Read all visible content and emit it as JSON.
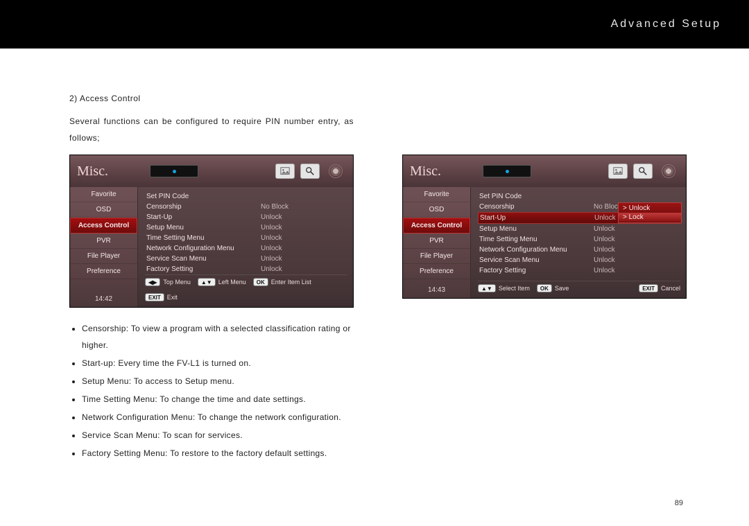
{
  "header": {
    "title": "Advanced Setup"
  },
  "page_number": "89",
  "section": {
    "heading": "2) Access Control",
    "intro": "Several functions can be configured to require PIN number entry, as follows;",
    "bullets": [
      "Censorship: To view a program with a selected classification rating or higher.",
      "Start-up: Every time the FV-L1 is turned on.",
      "Setup Menu: To access to Setup menu.",
      "Time Setting Menu: To change the time and date settings.",
      "Network Configuration Menu: To change the network configuration.",
      "Service Scan Menu: To scan for services.",
      "Factory Setting Menu: To restore to the factory default settings."
    ]
  },
  "screenshots": {
    "left": {
      "title": "Misc.",
      "time": "14:42",
      "sidebar": [
        "Favorite",
        "OSD",
        "Access Control",
        "PVR",
        "File Player",
        "Preference"
      ],
      "sidebar_selected": 2,
      "rows": [
        {
          "label": "Set PIN Code",
          "value": ""
        },
        {
          "label": "Censorship",
          "value": "No Block"
        },
        {
          "label": "Start-Up",
          "value": "Unlock"
        },
        {
          "label": "Setup Menu",
          "value": "Unlock"
        },
        {
          "label": "Time Setting Menu",
          "value": "Unlock"
        },
        {
          "label": "Network Configuration Menu",
          "value": "Unlock"
        },
        {
          "label": "Service Scan Menu",
          "value": "Unlock"
        },
        {
          "label": "Factory Setting",
          "value": "Unlock"
        }
      ],
      "footer": [
        {
          "btn": "◀▶",
          "text": "Top Menu"
        },
        {
          "btn": "▲▼",
          "text": "Left Menu"
        },
        {
          "btn": "OK",
          "text": "Enter Item List"
        },
        {
          "btn": "EXIT",
          "text": "Exit"
        }
      ]
    },
    "right": {
      "title": "Misc.",
      "time": "14:43",
      "sidebar": [
        "Favorite",
        "OSD",
        "Access Control",
        "PVR",
        "File Player",
        "Preference"
      ],
      "sidebar_selected": 2,
      "rows": [
        {
          "label": "Set PIN Code",
          "value": ""
        },
        {
          "label": "Censorship",
          "value": "No Block"
        },
        {
          "label": "Start-Up",
          "value": "Unlock",
          "selected": true
        },
        {
          "label": "Setup Menu",
          "value": "Unlock"
        },
        {
          "label": "Time Setting Menu",
          "value": "Unlock"
        },
        {
          "label": "Network Configuration Menu",
          "value": "Unlock"
        },
        {
          "label": "Service Scan Menu",
          "value": "Unlock"
        },
        {
          "label": "Factory Setting",
          "value": "Unlock"
        }
      ],
      "options": [
        "Unlock",
        "Lock"
      ],
      "option_selected": 1,
      "footer": [
        {
          "btn": "▲▼",
          "text": "Select Item"
        },
        {
          "btn": "OK",
          "text": "Save"
        },
        {
          "btn": "EXIT",
          "text": "Cancel"
        }
      ]
    }
  }
}
